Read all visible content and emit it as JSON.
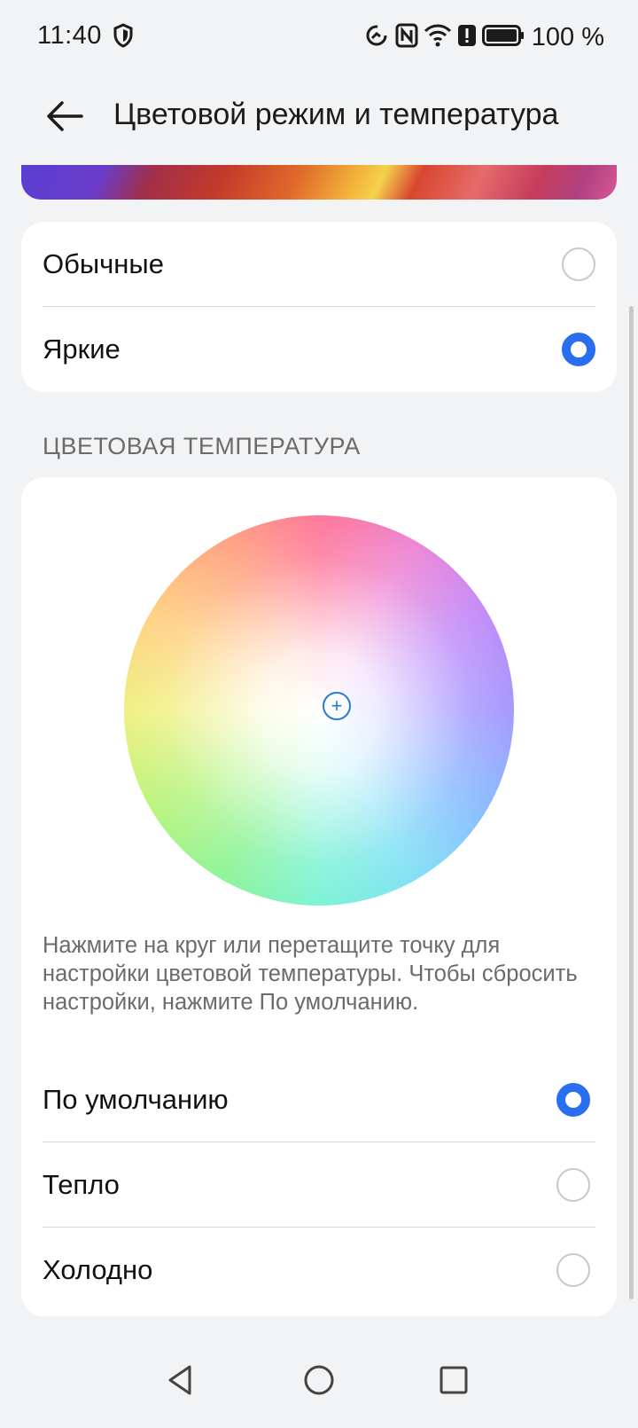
{
  "status_bar": {
    "time": "11:40",
    "battery_text": "100 %",
    "icons": [
      "shield-icon",
      "data-saver-icon",
      "nfc-icon",
      "wifi-icon",
      "alert-icon",
      "battery-icon"
    ]
  },
  "header": {
    "title": "Цветовой режим и температура",
    "back_icon": "back-arrow-icon"
  },
  "color_mode": {
    "options": [
      {
        "label": "Обычные",
        "selected": false
      },
      {
        "label": "Яркие",
        "selected": true
      }
    ]
  },
  "color_temperature": {
    "section_title": "ЦВЕТОВАЯ ТЕМПЕРАТУРА",
    "wheel_handle_symbol": "+",
    "hint": "Нажмите на круг или перетащите точку для настройки цветовой температуры. Чтобы сбросить настройки, нажмите По умолчанию.",
    "options": [
      {
        "label": "По умолчанию",
        "selected": true
      },
      {
        "label": "Тепло",
        "selected": false
      },
      {
        "label": "Холодно",
        "selected": false
      }
    ]
  },
  "colors": {
    "accent": "#2a6ef0",
    "background": "#f1f3f5",
    "card": "#ffffff"
  },
  "nav_bar": {
    "icons": [
      "back-triangle-icon",
      "home-circle-icon",
      "recents-square-icon"
    ]
  }
}
